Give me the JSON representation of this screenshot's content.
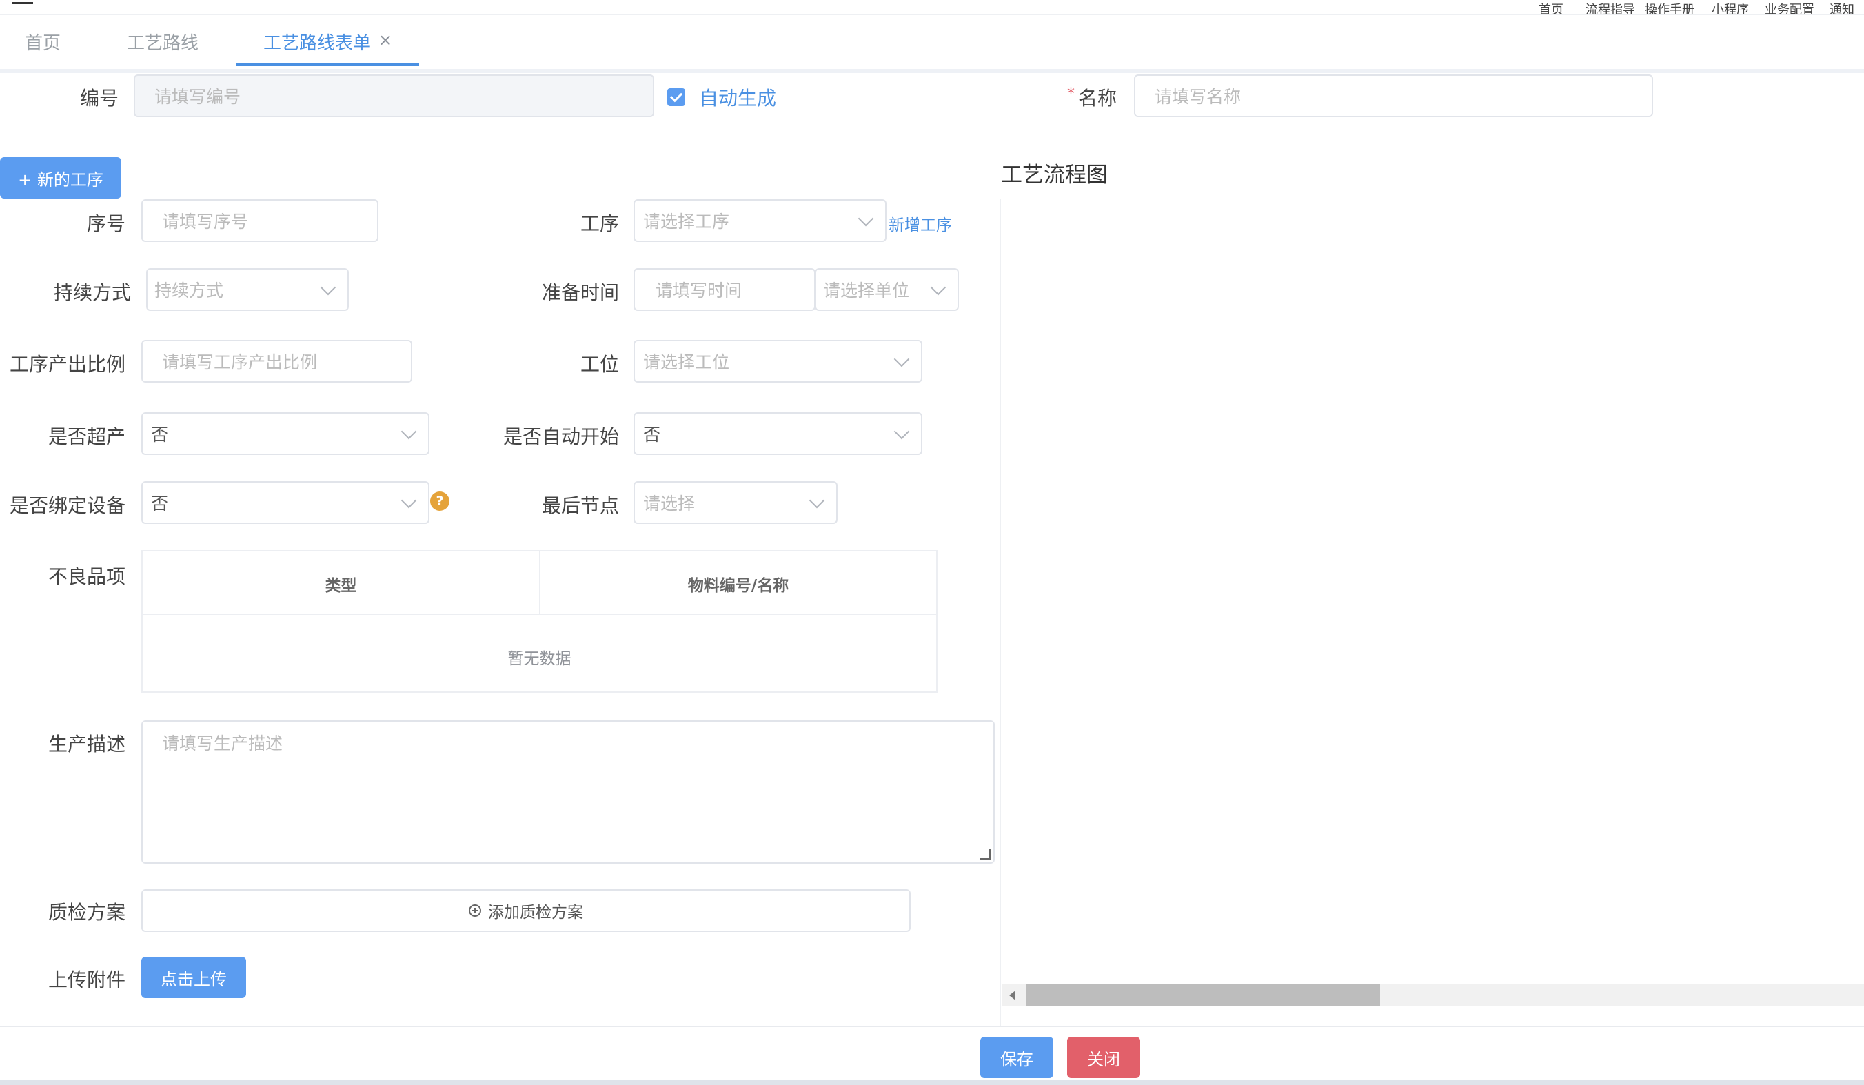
{
  "top_nav": {
    "items": [
      "首页",
      "流程指导",
      "操作手册",
      "小程序",
      "业务配置",
      "通知"
    ]
  },
  "tabs": [
    {
      "label": "首页"
    },
    {
      "label": "工艺路线"
    },
    {
      "label": "工艺路线表单",
      "close": "×"
    }
  ],
  "header_form": {
    "code_label": "编号",
    "code_placeholder": "请填写编号",
    "auto_generate_label": "自动生成",
    "required_mark": "*",
    "name_label": "名称",
    "name_placeholder": "请填写名称"
  },
  "new_process_button": "+ 新的工序",
  "flow_chart_title": "工艺流程图",
  "form": {
    "seq_label": "序号",
    "seq_placeholder": "请填写序号",
    "process_label": "工序",
    "process_placeholder": "请选择工序",
    "add_process_link": "新增工序",
    "duration_label": "持续方式",
    "duration_placeholder": "持续方式",
    "prep_time_label": "准备时间",
    "prep_time_placeholder": "请填写时间",
    "unit_placeholder": "请选择单位",
    "output_ratio_label": "工序产出比例",
    "output_ratio_placeholder": "请填写工序产出比例",
    "station_label": "工位",
    "station_placeholder": "请选择工位",
    "overproduce_label": "是否超产",
    "overproduce_value": "否",
    "auto_start_label": "是否自动开始",
    "auto_start_value": "否",
    "bind_device_label": "是否绑定设备",
    "bind_device_value": "否",
    "help_glyph": "?",
    "last_node_label": "最后节点",
    "last_node_placeholder": "请选择",
    "defects_label": "不良品项",
    "defects_table": {
      "columns": [
        "类型",
        "物料编号/名称"
      ],
      "empty_text": "暂无数据"
    },
    "desc_label": "生产描述",
    "desc_placeholder": "请填写生产描述",
    "qc_label": "质检方案",
    "qc_add_label": "添加质检方案",
    "attach_label": "上传附件",
    "upload_button": "点击上传"
  },
  "footer": {
    "save_label": "保存",
    "close_label": "关闭"
  },
  "colors": {
    "primary": "#5b9cf0",
    "danger": "#e2606a",
    "accent_text": "#4a90e2",
    "help_icon": "#e5a33a"
  }
}
